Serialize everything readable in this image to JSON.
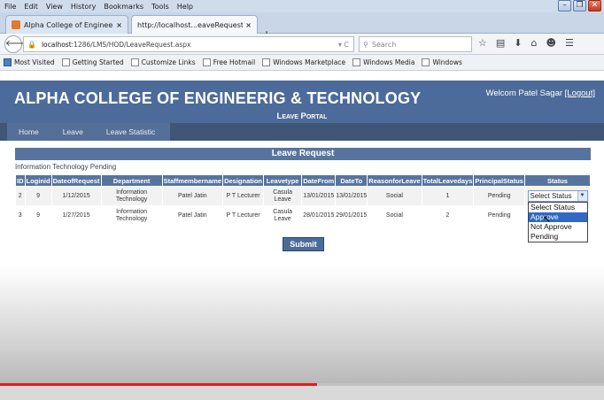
{
  "browser": {
    "menu": [
      "File",
      "Edit",
      "View",
      "History",
      "Bookmarks",
      "Tools",
      "Help"
    ],
    "tabs": [
      {
        "label": "Alpha College of Engineering ...",
        "active": false
      },
      {
        "label": "http://localhost...eaveRequest.aspx",
        "active": true
      }
    ],
    "new_tab": "+",
    "url_host": "localhost",
    "url_rest": ":1286/LMS/HOD/LeaveRequest.aspx",
    "reload": "▾ C",
    "search_placeholder": "Search",
    "bookmarks": [
      "Most Visited",
      "Getting Started",
      "Customize Links",
      "Free Hotmail",
      "Windows Marketplace",
      "Windows Media",
      "Windows"
    ]
  },
  "site": {
    "title": "ALPHA COLLEGE OF ENGINEERIG & TECHNOLOGY",
    "welcome_prefix": "Welcom Patel Sagar",
    "logout": "[Logout]",
    "portal": "Leave Portal",
    "nav": {
      "home": "Home",
      "leave": "Leave",
      "statistic": "Leave Statistic"
    }
  },
  "section": {
    "title": "Leave Request",
    "subtitle": "Information Technology Pending"
  },
  "table": {
    "headers": [
      "ID",
      "Loginid",
      "DateofRequest",
      "Department",
      "Staffmembername",
      "Designation",
      "Leavetype",
      "DateFrom",
      "DateTo",
      "ReasonforLeave",
      "TotalLeavedays",
      "PrincipalStatus",
      "Status"
    ],
    "rows": [
      {
        "id": "2",
        "loginid": "9",
        "date": "1/12/2015",
        "dept": "Information Technology",
        "staff": "Patel Jatin",
        "designation": "P T Lecturer",
        "type": "Casula Leave",
        "from": "13/01/2015",
        "to": "13/01/2015",
        "reason": "Social",
        "days": "1",
        "principal": "Pending",
        "status": "Select Status"
      },
      {
        "id": "3",
        "loginid": "9",
        "date": "1/27/2015",
        "dept": "Information Technology",
        "staff": "Patel Jatin",
        "designation": "P T Lecturer",
        "type": "Casula Leave",
        "from": "28/01/2015",
        "to": "29/01/2015",
        "reason": "Social",
        "days": "2",
        "principal": "Pending",
        "status": ""
      }
    ]
  },
  "dropdown_options": [
    "Select Status",
    "Approve",
    "Not Approve",
    "Pending"
  ],
  "dropdown_highlighted": "Approve",
  "submit_label": "Submit",
  "video": {
    "progress": 0.525,
    "accent": "#e21b1b"
  },
  "colors": {
    "header": "#4c6b9a",
    "nav": "#3f5677",
    "table_head": "#57749f"
  }
}
